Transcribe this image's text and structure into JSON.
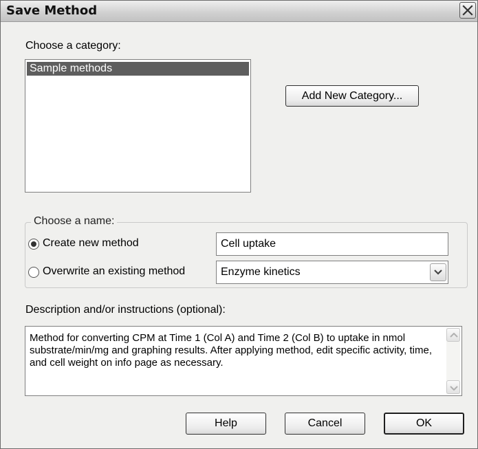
{
  "dialog": {
    "title": "Save Method"
  },
  "category": {
    "label": "Choose a category:",
    "items": [
      "Sample methods"
    ],
    "add_button_label": "Add New Category..."
  },
  "name_group": {
    "legend": "Choose a name:",
    "create_option_label": "Create new method",
    "create_value": "Cell uptake",
    "overwrite_option_label": "Overwrite an existing method",
    "overwrite_selected": "Enzyme kinetics",
    "selected_option": "create"
  },
  "description": {
    "label": "Description and/or instructions (optional):",
    "text": "Method for converting CPM at Time 1 (Col A) and Time 2 (Col B) to uptake in nmol substrate/min/mg and graphing results. After applying method, edit specific activity, time, and cell weight on info page as necessary."
  },
  "buttons": {
    "help": "Help",
    "cancel": "Cancel",
    "ok": "OK"
  },
  "icons": {
    "close": "close-icon",
    "dropdown": "chevron-down-icon",
    "scroll_up": "scroll-up-icon",
    "scroll_down": "scroll-down-icon"
  }
}
